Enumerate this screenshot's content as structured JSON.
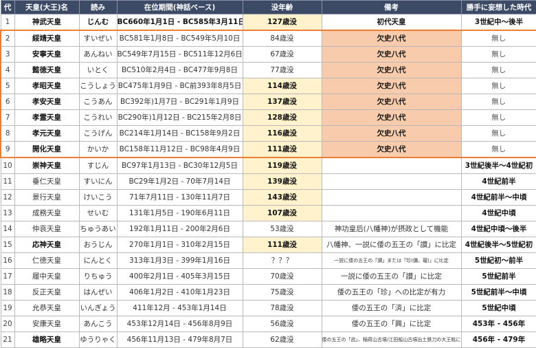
{
  "headers": [
    "代",
    "天皇(大王)名",
    "読み",
    "在位期間(神話ベース)",
    "没年齢",
    "備考",
    "勝手に妄想した時代"
  ],
  "rows": [
    {
      "gen": "1",
      "name": "神武天皇",
      "reading": "じんむ",
      "reign": "BC660年1月1日 - BC585年3月11日",
      "age": "127歳没",
      "note": "初代天皇",
      "period": "3世紀中～後半"
    },
    {
      "gen": "2",
      "name": "綏靖天皇",
      "reading": "すいぜい",
      "reign": "BC581年1月8日 - BC549年5月10日",
      "age": "84歳没",
      "note": "欠史八代",
      "period": "無し"
    },
    {
      "gen": "3",
      "name": "安寧天皇",
      "reading": "あんねい",
      "reign": "BC549年7月15日 - BC511年12月6日",
      "age": "67歳没",
      "note": "欠史八代",
      "period": "無し"
    },
    {
      "gen": "4",
      "name": "懿徳天皇",
      "reading": "いとく",
      "reign": "BC510年2月4日 - BC477年9月8日",
      "age": "77歳没",
      "note": "欠史八代",
      "period": "無し"
    },
    {
      "gen": "5",
      "name": "孝昭天皇",
      "reading": "こうしょう",
      "reign": "BC475年1月9日 - BC前393年8月5日",
      "age": "114歳没",
      "note": "欠史八代",
      "period": "無し"
    },
    {
      "gen": "6",
      "name": "孝安天皇",
      "reading": "こうあん",
      "reign": "BC392年)1月7日 - BC291年1月9日",
      "age": "137歳没",
      "note": "欠史八代",
      "period": "無し"
    },
    {
      "gen": "7",
      "name": "孝霊天皇",
      "reading": "こうれい",
      "reign": "BC290年)1月12日 - BC215年2月8日",
      "age": "128歳没",
      "note": "欠史八代",
      "period": "無し"
    },
    {
      "gen": "8",
      "name": "孝元天皇",
      "reading": "こうげん",
      "reign": "BC214年1月14日 - BC158年9月2日",
      "age": "116歳没",
      "note": "欠史八代",
      "period": "無し"
    },
    {
      "gen": "9",
      "name": "開化天皇",
      "reading": "かいか",
      "reign": "BC158年11月12日 - BC98年4月9日",
      "age": "111歳没",
      "note": "欠史八代",
      "period": "無し"
    },
    {
      "gen": "10",
      "name": "崇神天皇",
      "reading": "すじん",
      "reign": "BC97年1月13日 - BC30年12月5日",
      "age": "119歳没",
      "note": "",
      "period": "3世紀後半～4世紀初"
    },
    {
      "gen": "11",
      "name": "垂仁天皇",
      "reading": "すいにん",
      "reign": "BC29年1月2日 - 70年7月14日",
      "age": "139歳没",
      "note": "",
      "period": "4世紀前半"
    },
    {
      "gen": "12",
      "name": "景行天皇",
      "reading": "けいこう",
      "reign": "71年7月11日 - 130年11月7日",
      "age": "143歳没",
      "note": "",
      "period": "4世紀前半～中頃"
    },
    {
      "gen": "13",
      "name": "成務天皇",
      "reading": "せいむ",
      "reign": "131年1月5日 - 190年6月11日",
      "age": "107歳没",
      "note": "",
      "period": "4世紀中頃"
    },
    {
      "gen": "14",
      "name": "仲哀天皇",
      "reading": "ちゅうあい",
      "reign": "192年1月11日 - 200年2月6日",
      "age": "53歳没",
      "note": "神功皇后(八幡神)が摂政として機能",
      "period": "4世紀中頃～後半"
    },
    {
      "gen": "15",
      "name": "応神天皇",
      "reading": "おうじん",
      "reign": "270年1月1日 - 310年2月15日",
      "age": "111歳没",
      "note": "八幡神、一説に倭の五王の「讃」に比定",
      "period": "4世紀後半～5世紀初"
    },
    {
      "gen": "16",
      "name": "仁徳天皇",
      "reading": "にんとく",
      "reign": "313年1月3日 - 399年1月16日",
      "age": "？？？",
      "note": "一説に倭の五王の「讃」または「珍(彌、瓏)」に比定",
      "period": "5世紀初～前半"
    },
    {
      "gen": "17",
      "name": "履中天皇",
      "reading": "りちゅう",
      "reign": "400年2月1日 - 405年3月15日",
      "age": "70歳没",
      "note": "一説に倭の五王の「讃」に比定",
      "period": "5世紀前半"
    },
    {
      "gen": "18",
      "name": "反正天皇",
      "reading": "はんぜい",
      "reign": "406年1月2日 - 410年1月23日",
      "age": "75歳没",
      "note": "倭の五王の「珍」への比定が有力",
      "period": "5世紀前半～中頃"
    },
    {
      "gen": "19",
      "name": "允恭天皇",
      "reading": "いんぎょう",
      "reign": "411年12月 - 453年1月14日",
      "age": "78歳没",
      "note": "倭の五王の「済」に比定",
      "period": "5世紀中頃"
    },
    {
      "gen": "20",
      "name": "安康天皇",
      "reading": "あんこう",
      "reign": "453年12月14日 - 456年8月9日",
      "age": "56歳没",
      "note": "倭の五王の「興」に比定",
      "period": "453年 - 456年"
    },
    {
      "gen": "21",
      "name": "雄略天皇",
      "reading": "ゆうりゃく",
      "reign": "456年11月13日 - 479年8月7日",
      "age": "62歳没",
      "note": "倭の五王の「武」、稲荷山古墳/江田船山古墳出土鉄刀の大王銘に比定",
      "period": "456年 - 479年"
    }
  ],
  "colors": {
    "header_bg": "#3c4a66",
    "age_highlight": "#fff2cc",
    "note_highlight": "#f8cbad",
    "gap_frame": "#ed7d31"
  }
}
